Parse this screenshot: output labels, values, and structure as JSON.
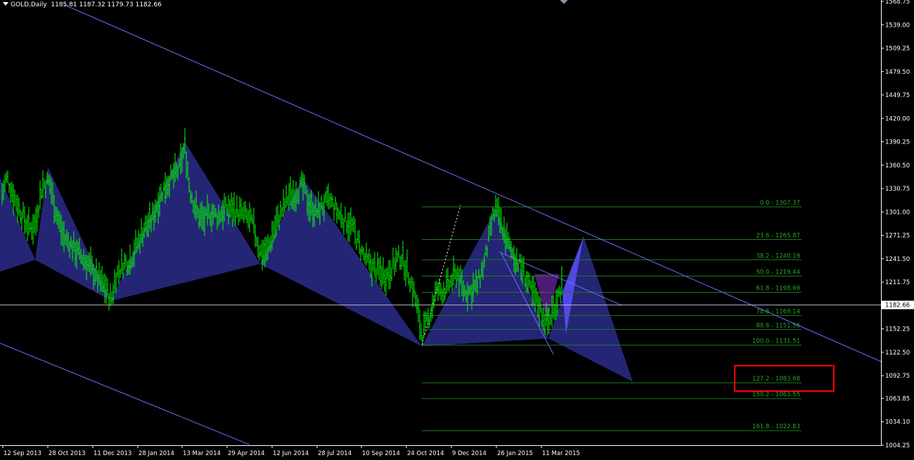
{
  "header": {
    "symbol": "GOLD,Daily",
    "ohlc": "1185.81 1187.32 1179.73 1182.66"
  },
  "colors": {
    "background": "#000000",
    "axis": "#ffffff",
    "candle": "#00ff00",
    "harmonic_fill": "#2b2c8a",
    "harmonic_fill_alt": "#5a1f8c",
    "harmonic_fill_bright": "#5b4fff",
    "trendline": "#6a70ff",
    "fib_line": "#1f7a1f",
    "fib_text": "#2aa52a",
    "highlight_box": "#ff0000",
    "price_line": "#b8b8c8"
  },
  "chart_data": {
    "type": "candlestick",
    "title": "GOLD,Daily",
    "current_price": 1182.66,
    "ylim": [
      1004.25,
      1568.75
    ],
    "y_ticks": [
      "1568.75",
      "1539.00",
      "1509.25",
      "1479.50",
      "1449.75",
      "1420.00",
      "1390.25",
      "1360.50",
      "1330.75",
      "1301.00",
      "1271.25",
      "1241.50",
      "1211.75",
      "1182.66",
      "1152.25",
      "1122.50",
      "1092.75",
      "1063.85",
      "1034.10",
      "1004.25"
    ],
    "x_ticks": [
      "12 Sep 2013",
      "28 Oct 2013",
      "11 Dec 2013",
      "28 Jan 2014",
      "13 Mar 2014",
      "29 Apr 2014",
      "12 Jun 2014",
      "28 Jul 2014",
      "10 Sep 2014",
      "24 Oct 2014",
      "9 Dec 2014",
      "26 Jan 2015",
      "11 Mar 2015"
    ],
    "x_tick_pos": [
      4,
      68,
      132,
      196,
      259,
      323,
      387,
      451,
      514,
      578,
      642,
      706,
      770
    ],
    "price_path": [
      [
        0,
        1315
      ],
      [
        10,
        1345
      ],
      [
        20,
        1320
      ],
      [
        30,
        1300
      ],
      [
        42,
        1280
      ],
      [
        50,
        1285
      ],
      [
        60,
        1335
      ],
      [
        70,
        1340
      ],
      [
        80,
        1300
      ],
      [
        90,
        1270
      ],
      [
        100,
        1260
      ],
      [
        110,
        1250
      ],
      [
        120,
        1240
      ],
      [
        130,
        1230
      ],
      [
        140,
        1215
      ],
      [
        150,
        1205
      ],
      [
        158,
        1188
      ],
      [
        165,
        1220
      ],
      [
        175,
        1235
      ],
      [
        185,
        1240
      ],
      [
        195,
        1260
      ],
      [
        205,
        1280
      ],
      [
        215,
        1290
      ],
      [
        225,
        1315
      ],
      [
        235,
        1335
      ],
      [
        245,
        1345
      ],
      [
        255,
        1355
      ],
      [
        263,
        1385
      ],
      [
        270,
        1330
      ],
      [
        280,
        1300
      ],
      [
        290,
        1290
      ],
      [
        300,
        1300
      ],
      [
        310,
        1295
      ],
      [
        320,
        1305
      ],
      [
        330,
        1305
      ],
      [
        340,
        1300
      ],
      [
        350,
        1295
      ],
      [
        360,
        1285
      ],
      [
        370,
        1250
      ],
      [
        380,
        1250
      ],
      [
        390,
        1280
      ],
      [
        400,
        1300
      ],
      [
        410,
        1320
      ],
      [
        420,
        1325
      ],
      [
        430,
        1335
      ],
      [
        440,
        1310
      ],
      [
        450,
        1300
      ],
      [
        460,
        1310
      ],
      [
        470,
        1315
      ],
      [
        480,
        1300
      ],
      [
        490,
        1290
      ],
      [
        500,
        1285
      ],
      [
        510,
        1260
      ],
      [
        520,
        1240
      ],
      [
        530,
        1230
      ],
      [
        540,
        1225
      ],
      [
        550,
        1220
      ],
      [
        560,
        1235
      ],
      [
        570,
        1245
      ],
      [
        580,
        1225
      ],
      [
        590,
        1195
      ],
      [
        600,
        1145
      ],
      [
        610,
        1165
      ],
      [
        620,
        1200
      ],
      [
        630,
        1200
      ],
      [
        640,
        1210
      ],
      [
        650,
        1225
      ],
      [
        660,
        1200
      ],
      [
        670,
        1200
      ],
      [
        680,
        1210
      ],
      [
        690,
        1240
      ],
      [
        700,
        1290
      ],
      [
        705,
        1305
      ],
      [
        715,
        1280
      ],
      [
        725,
        1255
      ],
      [
        735,
        1240
      ],
      [
        745,
        1225
      ],
      [
        755,
        1200
      ],
      [
        765,
        1185
      ],
      [
        775,
        1165
      ],
      [
        780,
        1160
      ],
      [
        790,
        1185
      ],
      [
        800,
        1210
      ]
    ],
    "fib_levels": [
      {
        "label": "0.0 - 1307.37",
        "price": 1307.37
      },
      {
        "label": "23.6 - 1265.87",
        "price": 1265.87
      },
      {
        "label": "38.2 - 1240.19",
        "price": 1240.19
      },
      {
        "label": "50.0 - 1219.44",
        "price": 1219.44
      },
      {
        "label": "61.8 - 1198.69",
        "price": 1198.69
      },
      {
        "label": "78.6 - 1169.14",
        "price": 1169.14
      },
      {
        "label": "88.6 - 1151.56",
        "price": 1151.56
      },
      {
        "label": "100.0 - 1131.51",
        "price": 1131.51
      },
      {
        "label": "127.2 - 1083.68",
        "price": 1083.68
      },
      {
        "label": "150.2 - 1063.55",
        "price": 1063.55
      },
      {
        "label": "161.8 - 1022.83",
        "price": 1022.83
      }
    ],
    "harmonic_polygons": [
      {
        "fill": "#2b2c8a",
        "points": [
          [
            0,
            1345
          ],
          [
            50,
            1240
          ],
          [
            0,
            1225
          ]
        ]
      },
      {
        "fill": "#2b2c8a",
        "points": [
          [
            50,
            1240
          ],
          [
            68,
            1358
          ],
          [
            158,
            1188
          ]
        ]
      },
      {
        "fill": "#2b2c8a",
        "points": [
          [
            158,
            1188
          ],
          [
            263,
            1390
          ],
          [
            370,
            1235
          ]
        ]
      },
      {
        "fill": "#2b2c8a",
        "points": [
          [
            370,
            1235
          ],
          [
            430,
            1345
          ],
          [
            600,
            1130
          ]
        ]
      },
      {
        "fill": "#2b2c8a",
        "points": [
          [
            600,
            1130
          ],
          [
            705,
            1305
          ],
          [
            780,
            1140
          ]
        ]
      },
      {
        "fill": "#2b2c8a",
        "points": [
          [
            780,
            1140
          ],
          [
            830,
            1270
          ],
          [
            900,
            1085
          ]
        ]
      },
      {
        "fill": "#5a1f8c",
        "points": [
          [
            760,
            1222
          ],
          [
            795,
            1222
          ],
          [
            778,
            1162
          ]
        ]
      },
      {
        "fill": "#5b4fff",
        "points": [
          [
            800,
            1200
          ],
          [
            830,
            1270
          ],
          [
            805,
            1145
          ]
        ]
      }
    ],
    "trendlines": [
      {
        "from": [
          90,
          1565
        ],
        "to": [
          1255,
          1110
        ]
      },
      {
        "from": [
          0,
          1134
        ],
        "to": [
          355,
          1005
        ]
      },
      {
        "from": [
          710,
          1250
        ],
        "to": [
          885,
          1182
        ]
      },
      {
        "from": [
          712,
          1250
        ],
        "to": [
          787,
          1120
        ]
      },
      {
        "from": [
          600,
          1132
        ],
        "to": [
          655,
          1310
        ]
      }
    ]
  }
}
